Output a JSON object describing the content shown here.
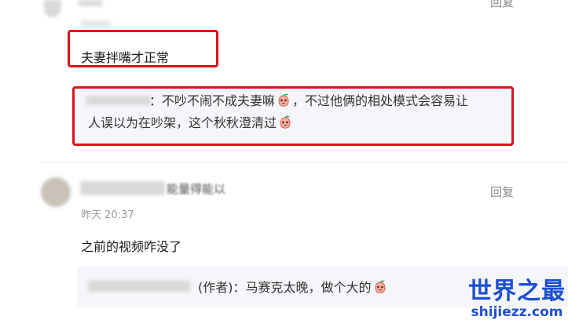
{
  "comment1": {
    "reply_label": "回复",
    "text": "夫妻拌嘴才正常",
    "quote": {
      "part1": "：不吵不闹不成夫妻嘛",
      "part2": "，不过他俩的相处模式会容易让",
      "line2": "人误以为在吵架，这个秋秋澄清过"
    }
  },
  "comment2": {
    "reply_label": "回复",
    "username_suffix": "能量得能以",
    "timestamp": "昨天 20:37",
    "text": "之前的视频咋没了",
    "quote": {
      "author_tag": "(作者)",
      "reply": "：马赛克太晚，做个大的"
    }
  },
  "watermark": {
    "title": "世界之最",
    "url": "shijiezz.com"
  },
  "colors": {
    "highlight_red": "#e0101a",
    "watermark_blue": "#1e4fd0",
    "quote_bg": "#f4f6f9"
  },
  "icons": [
    "peach-emoji-icon",
    "peach-emoji-icon",
    "peach-emoji-icon"
  ]
}
